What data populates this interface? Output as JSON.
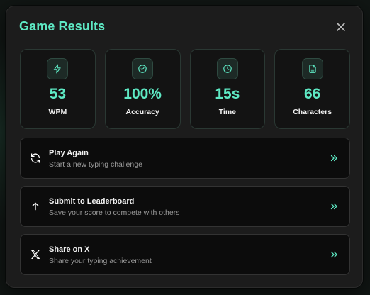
{
  "modal": {
    "title": "Game Results",
    "close_icon": "close-icon"
  },
  "stats": [
    {
      "icon": "lightning-icon",
      "value": "53",
      "label": "WPM"
    },
    {
      "icon": "check-circle-icon",
      "value": "100%",
      "label": "Accuracy"
    },
    {
      "icon": "clock-icon",
      "value": "15s",
      "label": "Time"
    },
    {
      "icon": "document-icon",
      "value": "66",
      "label": "Characters"
    }
  ],
  "actions": [
    {
      "icon": "refresh-icon",
      "title": "Play Again",
      "subtitle": "Start a new typing challenge"
    },
    {
      "icon": "arrow-up-icon",
      "title": "Submit to Leaderboard",
      "subtitle": "Save your score to compete with others"
    },
    {
      "icon": "x-logo-icon",
      "title": "Share on X",
      "subtitle": "Share your typing achievement"
    }
  ],
  "colors": {
    "accent": "#5ee9c4",
    "surface": "#1c1c1c",
    "card": "#131313",
    "action_bg": "#0c0c0c"
  }
}
